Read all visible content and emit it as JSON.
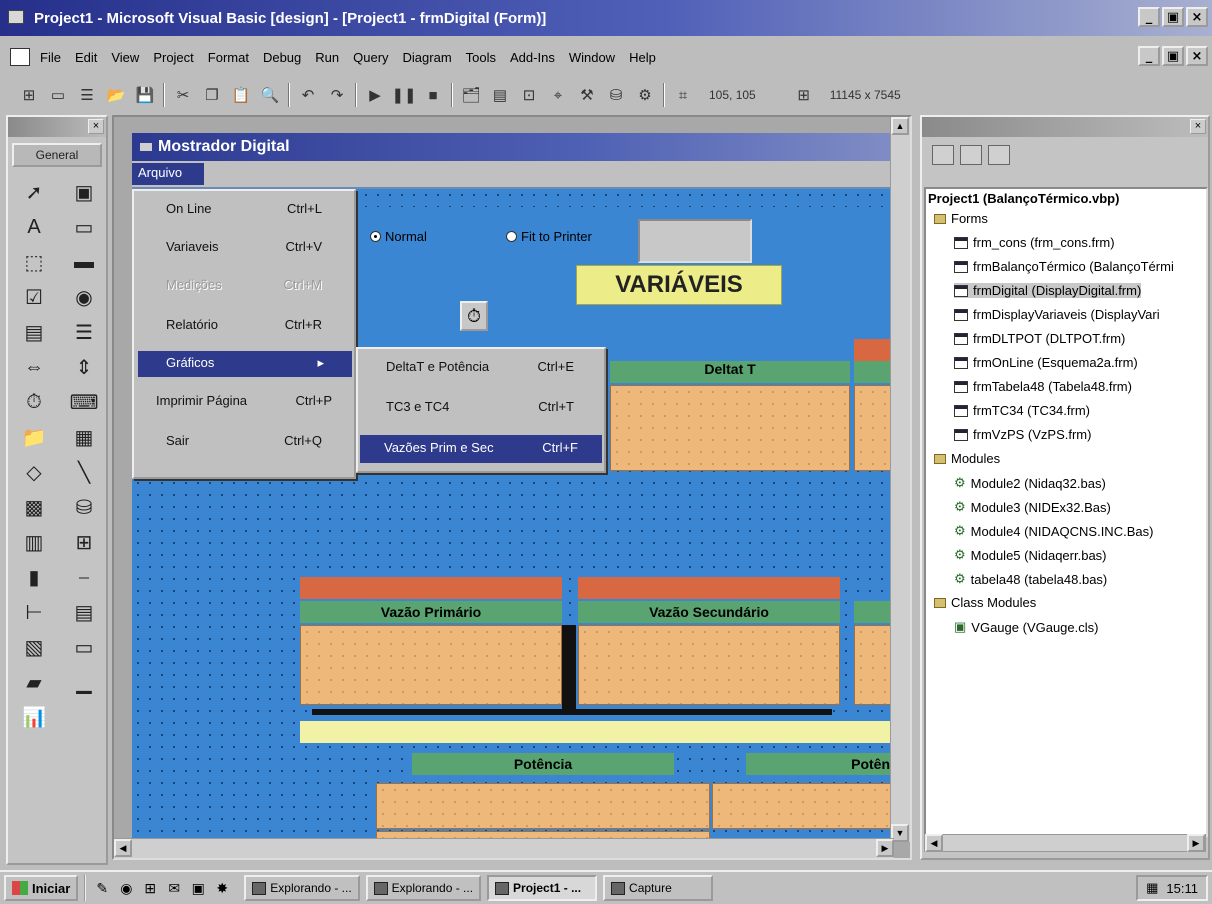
{
  "window": {
    "title": "Project1 - Microsoft Visual Basic [design] - [Project1 - frmDigital (Form)]",
    "controls": [
      "_",
      "▣",
      "×"
    ]
  },
  "menubar": [
    "File",
    "Edit",
    "View",
    "Project",
    "Format",
    "Debug",
    "Run",
    "Query",
    "Diagram",
    "Tools",
    "Add-Ins",
    "Window",
    "Help"
  ],
  "toolbar": {
    "position": "105, 105",
    "size": "11145 x 7545"
  },
  "toolbox": {
    "tab": "General",
    "tools": [
      "pointer-icon",
      "picturebox-icon",
      "label-icon",
      "textbox-icon",
      "frame-icon",
      "commandbutton-icon",
      "checkbox-icon",
      "optionbutton-icon",
      "combobox-icon",
      "listbox-icon",
      "hscrollbar-icon",
      "vscrollbar-icon",
      "timer-icon",
      "drivelistbox-icon",
      "dirlistbox-icon",
      "filelistbox-icon",
      "shape-icon",
      "line-icon",
      "image-icon",
      "data-icon",
      "ole-icon",
      "grid-icon",
      "chart-icon",
      "slider-icon",
      "treeview-icon",
      "listview-icon",
      "imagelist-icon",
      "tabstrip-icon",
      "progressbar-icon",
      "statusbar-icon",
      "mschart-icon"
    ]
  },
  "form": {
    "caption": "Mostrador Digital",
    "menu_caption": "Arquivo",
    "radio_normal": "Normal",
    "radio_fit": "Fit to Printer",
    "variaveis_title": "VARIÁVEIS",
    "deltat_label": "Deltat T",
    "vazao_primario": "Vazão Primário",
    "vazao_secundario": "Vazão Secundário",
    "potencia": "Potência",
    "potencia2": "Potên"
  },
  "file_menu": [
    {
      "label": "On Line",
      "shortcut": "Ctrl+L"
    },
    {
      "label": "Variaveis",
      "shortcut": "Ctrl+V"
    },
    {
      "label": "Medições",
      "shortcut": "Ctrl+M"
    },
    {
      "label": "Relatório",
      "shortcut": "Ctrl+R"
    },
    {
      "label": "Gráficos",
      "shortcut": "▸"
    },
    {
      "label": "Imprimir Página",
      "shortcut": "Ctrl+P"
    },
    {
      "label": "Sair",
      "shortcut": "Ctrl+Q"
    }
  ],
  "submenu": [
    {
      "label": "DeltaT e Potência",
      "shortcut": "Ctrl+E"
    },
    {
      "label": "TC3 e TC4",
      "shortcut": "Ctrl+T"
    },
    {
      "label": "Vazões Prim e Sec",
      "shortcut": "Ctrl+F"
    }
  ],
  "project_explorer": {
    "root": "Project1 (BalançoTérmico.vbp)",
    "forms_folder": "Forms",
    "forms": [
      "frm_cons (frm_cons.frm)",
      "frmBalançoTérmico (BalançoTérmi",
      "frmDigital (DisplayDigital.frm)",
      "frmDisplayVariaveis (DisplayVari",
      "frmDLTPOT (DLTPOT.frm)",
      "frmOnLine (Esquema2a.frm)",
      "frmTabela48 (Tabela48.frm)",
      "frmTC34 (TC34.frm)",
      "frmVzPS (VzPS.frm)"
    ],
    "modules_folder": "Modules",
    "modules": [
      "Module2 (Nidaq32.bas)",
      "Module3 (NIDEx32.Bas)",
      "Module4 (NIDAQCNS.INC.Bas)",
      "Module5 (Nidaqerr.bas)",
      "tabela48 (tabela48.bas)"
    ],
    "class_folder": "Class Modules",
    "classes": [
      "VGauge (VGauge.cls)"
    ]
  },
  "taskbar": {
    "start": "Iniciar",
    "tasks": [
      "Explorando - ...",
      "Explorando - ...",
      "Project1 - ...",
      "Capture"
    ],
    "clock": "15:11"
  }
}
